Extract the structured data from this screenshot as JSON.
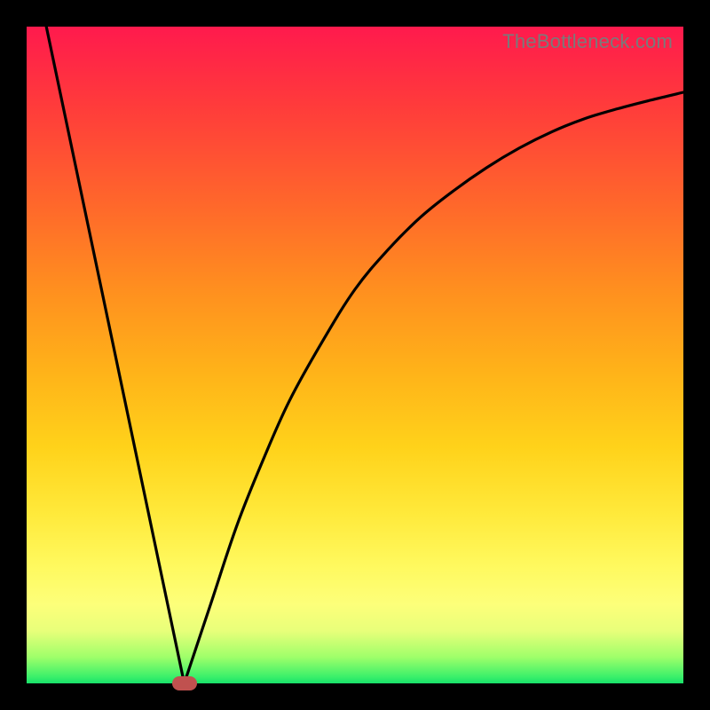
{
  "watermark": "TheBottleneck.com",
  "colors": {
    "gradient_top": "#ff1a4d",
    "gradient_bottom": "#18e06a",
    "curve": "#000000",
    "frame": "#000000",
    "marker": "#c0514f"
  },
  "chart_data": {
    "type": "line",
    "title": "",
    "xlabel": "",
    "ylabel": "",
    "xlim": [
      0,
      100
    ],
    "ylim": [
      0,
      100
    ],
    "grid": false,
    "legend": false,
    "marker": {
      "x": 24,
      "y": 0
    },
    "series": [
      {
        "name": "left-branch",
        "x": [
          3,
          24
        ],
        "y": [
          100,
          0
        ]
      },
      {
        "name": "right-branch",
        "x": [
          24,
          28,
          32,
          36,
          40,
          45,
          50,
          55,
          60,
          65,
          70,
          75,
          80,
          85,
          90,
          95,
          100
        ],
        "y": [
          0,
          12,
          24,
          34,
          43,
          52,
          60,
          66,
          71,
          75,
          78.5,
          81.5,
          84,
          86,
          87.5,
          88.8,
          90
        ]
      }
    ]
  }
}
